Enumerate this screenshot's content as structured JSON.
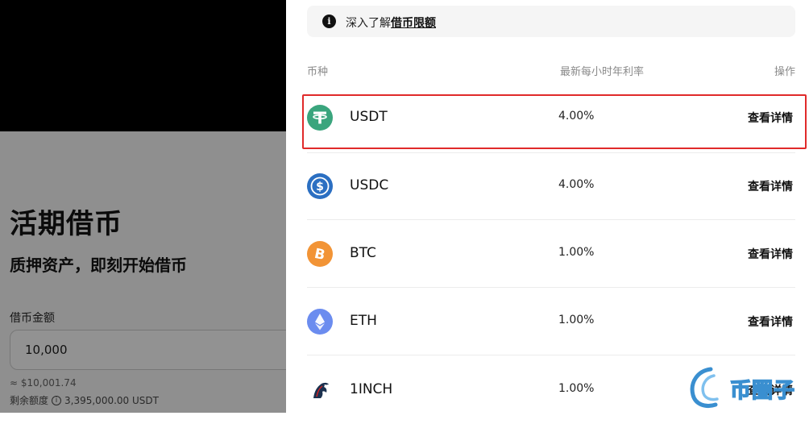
{
  "left": {
    "title": "活期借币",
    "subtitle": "质押资产，即刻开始借币",
    "amount_label": "借币金额",
    "amount_value": "10,000",
    "approx_value": "≈ $10,001.74",
    "remaining_label": "剩余额度",
    "remaining_value": "3,395,000.00 USDT",
    "info_glyph": "i"
  },
  "notice": {
    "icon_glyph": "i",
    "prefix": "深入了解",
    "link": "借币限额"
  },
  "table": {
    "headers": {
      "coin": "币种",
      "rate": "最新每小时年利率",
      "action": "操作"
    },
    "rows": [
      {
        "coin": "USDT",
        "rate": "4.00%",
        "action": "查看详情",
        "icon": "usdt-icon",
        "color": "#3aa57d"
      },
      {
        "coin": "USDC",
        "rate": "4.00%",
        "action": "查看详情",
        "icon": "usdc-icon",
        "color": "#2b6fc2"
      },
      {
        "coin": "BTC",
        "rate": "1.00%",
        "action": "查看详情",
        "icon": "btc-icon",
        "color": "#f29436"
      },
      {
        "coin": "ETH",
        "rate": "1.00%",
        "action": "查看详情",
        "icon": "eth-icon",
        "color": "#6b8cef"
      },
      {
        "coin": "1INCH",
        "rate": "1.00%",
        "action": "查看详情",
        "icon": "1inch-icon",
        "color": "#1b314f"
      }
    ]
  },
  "watermark": {
    "text": "币圈子"
  },
  "colors": {
    "highlight": "#e02a2a",
    "overlay": "#8f8f8f"
  }
}
